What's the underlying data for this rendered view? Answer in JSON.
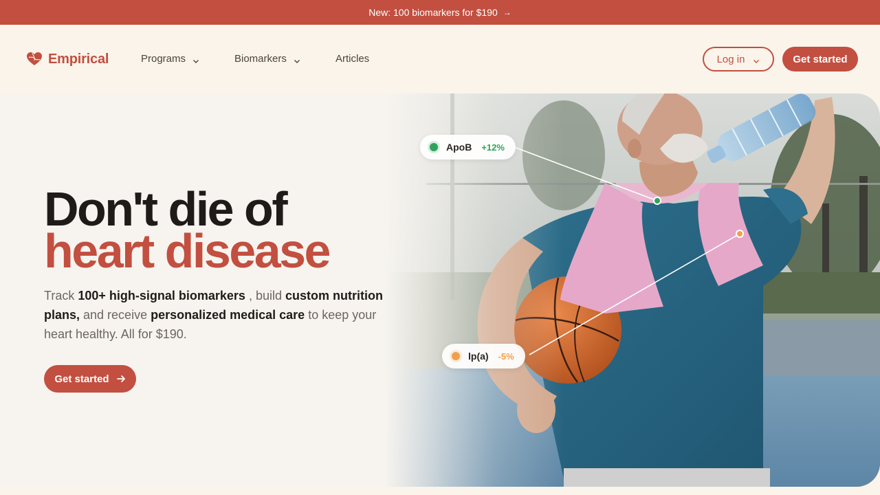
{
  "announcement": {
    "text": "New: 100 biomarkers for $190",
    "arrow": "→"
  },
  "brand": {
    "name": "Empirical",
    "logo_icon": "heart-icon",
    "color": "#c24f40"
  },
  "nav": {
    "links": [
      {
        "label": "Programs",
        "has_dropdown": true
      },
      {
        "label": "Biomarkers",
        "has_dropdown": true
      },
      {
        "label": "Articles",
        "has_dropdown": false
      }
    ],
    "login_label": "Log in",
    "cta_label": "Get started"
  },
  "hero": {
    "headline_line1": "Don't die of",
    "headline_line2": "heart disease",
    "sub": {
      "p1": "Track ",
      "b1": "100+ high-signal biomarkers",
      "p2": " , build ",
      "b2": "custom nutrition plans,",
      "p3": " and receive ",
      "b3": "personalized medical care",
      "p4": " to keep your heart healthy. All for $190."
    },
    "cta_label": "Get started"
  },
  "biomarkers": [
    {
      "name": "ApoB",
      "delta": "+12%",
      "color": "#2fa35a"
    },
    {
      "name": "lp(a)",
      "delta": "-5%",
      "color": "#f0a04a"
    }
  ],
  "colors": {
    "accent": "#c24f40",
    "background": "#fbf4ea"
  }
}
